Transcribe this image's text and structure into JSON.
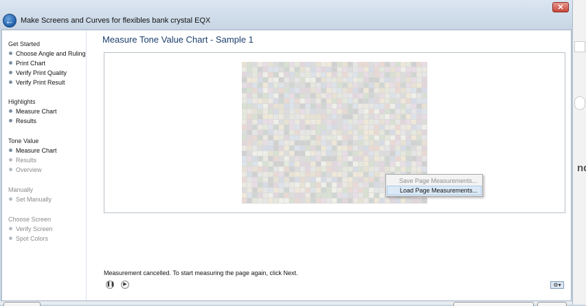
{
  "window": {
    "title": "Make Screens and Curves for flexibles bank crystal EQX",
    "back_icon": "back-arrow-icon",
    "close_label": "✕"
  },
  "background_window": {
    "fragment_text": "nd"
  },
  "sidebar": {
    "groups": [
      {
        "heading": "Get Started",
        "items": [
          "Choose Angle and Ruling",
          "Print Chart",
          "Verify Print Quality",
          "Verify Print Result"
        ]
      },
      {
        "heading": "Highlights",
        "items": [
          "Measure Chart",
          "Results"
        ]
      },
      {
        "heading": "Tone Value",
        "items": [
          "Measure Chart",
          "Results",
          "Overview"
        ]
      },
      {
        "heading": "Manually",
        "items": [
          "Set Manually"
        ]
      },
      {
        "heading": "Choose Screen",
        "items": [
          "Verify Screen",
          "Spot Colors"
        ]
      }
    ]
  },
  "main": {
    "page_title": "Measure Tone Value Chart - Sample 1",
    "status_message": "Measurement cancelled. To start measuring the page again, click Next.",
    "pause_icon": "pause-icon",
    "play_icon": "play-icon",
    "settings_icon": "gear-dropdown-icon"
  },
  "context_menu": {
    "items": [
      {
        "label": "Save Page Measurements...",
        "enabled": false
      },
      {
        "label": "Load Page Measurements...",
        "enabled": true,
        "highlighted": true
      }
    ]
  },
  "colors": {
    "title_blue": "#1c3f6e",
    "window_frame": "#c9d6e3",
    "menu_highlight": "#dbe9f7"
  }
}
